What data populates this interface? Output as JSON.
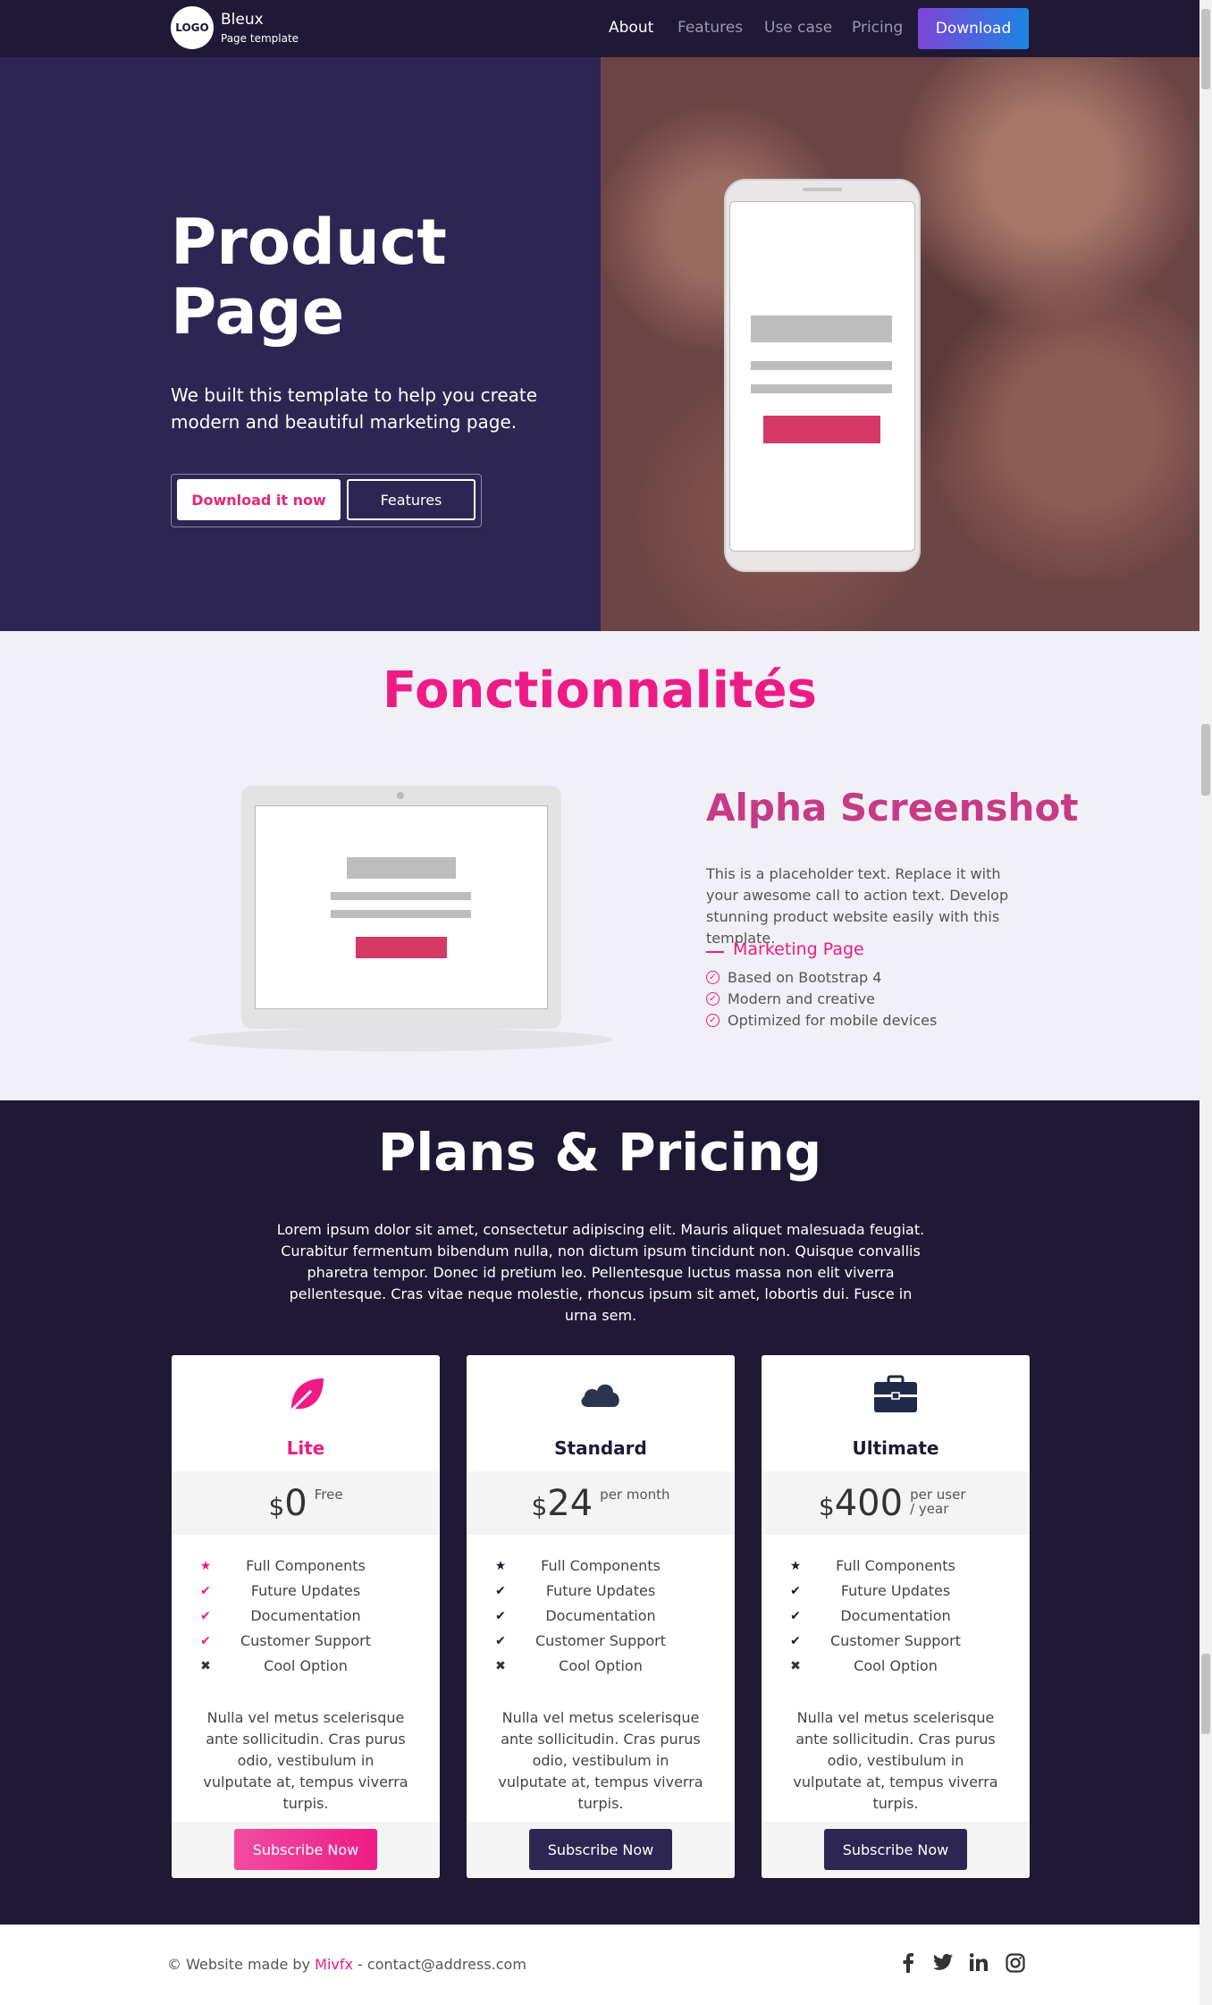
{
  "nav": {
    "logo": "LOGO",
    "brand_name": "Bleux",
    "brand_sub": "Page template",
    "links": [
      "About",
      "Features",
      "Use case",
      "Pricing"
    ],
    "download": "Download"
  },
  "hero": {
    "title": "Product Page",
    "subtitle": "We built this template to help you create modern and beautiful marketing page.",
    "btn_primary": "Download it now",
    "btn_secondary": "Features"
  },
  "features": {
    "title": "Fonctionnalités",
    "alpha_title": "Alpha Screenshot",
    "alpha_text": "This is a placeholder text. Replace it with your awesome call to action text. Develop stunning product website easily with this template.",
    "marketing_label": "Marketing Page",
    "checks": [
      "Based on Bootstrap 4",
      "Modern and creative",
      "Optimized for mobile devices"
    ]
  },
  "pricing": {
    "title": "Plans & Pricing",
    "intro": "Lorem ipsum dolor sit amet, consectetur adipiscing elit. Mauris aliquet malesuada feugiat. Curabitur fermentum bibendum nulla, non dictum ipsum tincidunt non. Quisque convallis pharetra tempor. Donec id pretium leo. Pellentesque luctus massa non elit viverra pellentesque. Cras vitae neque molestie, rhoncus ipsum sit amet, lobortis dui. Fusce in urna sem.",
    "plans": [
      {
        "name": "Lite",
        "icon": "leaf-icon",
        "currency": "$",
        "price": "0",
        "per": "Free",
        "accent": "#ee1b86",
        "features": [
          "Full Components",
          "Future Updates",
          "Documentation",
          "Customer Support",
          "Cool Option"
        ],
        "desc": "Nulla vel metus scelerisque ante sollicitudin. Cras purus odio, vestibulum in vulputate at, tempus viverra turpis.",
        "button": "Subscribe Now"
      },
      {
        "name": "Standard",
        "icon": "cloud-icon",
        "currency": "$",
        "price": "24",
        "per": "per month",
        "accent": "#1f1936",
        "features": [
          "Full Components",
          "Future Updates",
          "Documentation",
          "Customer Support",
          "Cool Option"
        ],
        "desc": "Nulla vel metus scelerisque ante sollicitudin. Cras purus odio, vestibulum in vulputate at, tempus viverra turpis.",
        "button": "Subscribe Now"
      },
      {
        "name": "Ultimate",
        "icon": "briefcase-icon",
        "currency": "$",
        "price": "400",
        "per": "per user / year",
        "accent": "#1f1936",
        "features": [
          "Full Components",
          "Future Updates",
          "Documentation",
          "Customer Support",
          "Cool Option"
        ],
        "desc": "Nulla vel metus scelerisque ante sollicitudin. Cras purus odio, vestibulum in vulputate at, tempus viverra turpis.",
        "button": "Subscribe Now"
      }
    ]
  },
  "footer": {
    "prefix": "© Website made by ",
    "author": "Mivfx",
    "suffix": " - contact@address.com",
    "social": [
      "facebook-icon",
      "twitter-icon",
      "linkedin-icon",
      "instagram-icon"
    ]
  },
  "colors": {
    "accent": "#ee1b86",
    "dark": "#1f1936",
    "hero": "#2e2652"
  }
}
